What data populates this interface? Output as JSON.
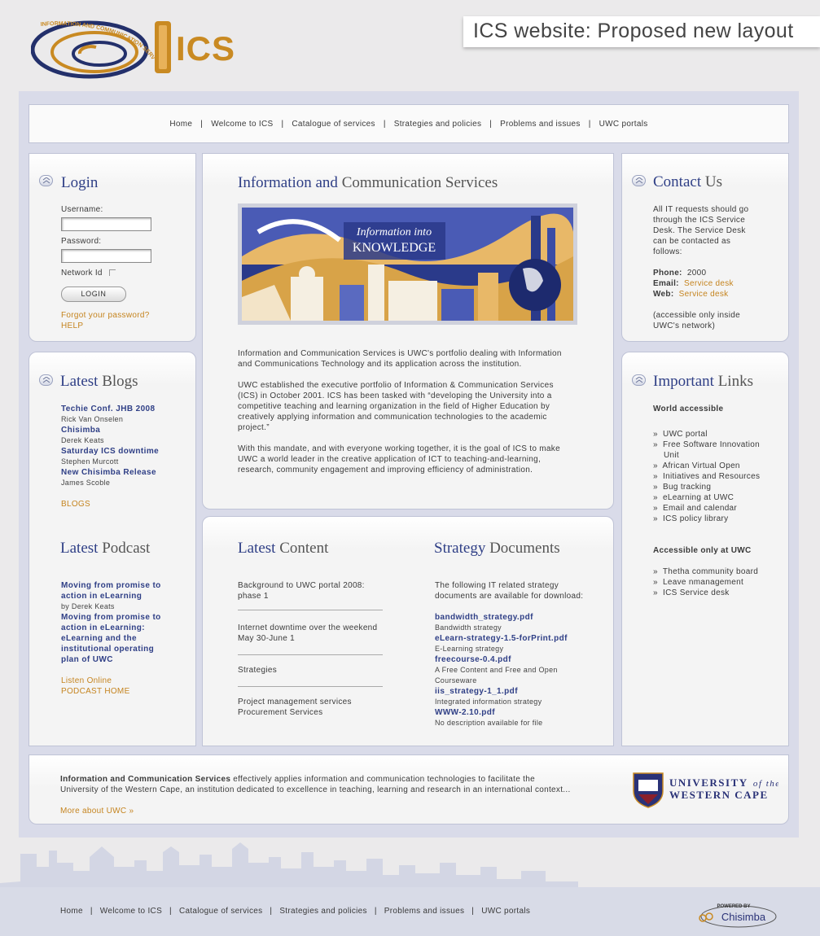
{
  "header": {
    "logo_text": "ICS",
    "logo_ring_text": "INFORMATION AND COMMUNICATION SERVICES",
    "page_title": "ICS website: Proposed new layout"
  },
  "nav": {
    "items": [
      "Home",
      "Welcome to ICS",
      "Catalogue of services",
      "Strategies and policies",
      "Problems and issues",
      "UWC portals"
    ],
    "separator": "|"
  },
  "login": {
    "heading_hl": "Login",
    "username_label": "Username:",
    "password_label": "Password:",
    "network_label": "Network Id",
    "login_button": "LOGIN",
    "forgot": "Forgot your password?",
    "help": "HELP"
  },
  "blogs": {
    "heading_hl": "Latest",
    "heading_rest": " Blogs",
    "items": [
      {
        "title": "Techie Conf. JHB 2008",
        "author": "Rick Van Onselen"
      },
      {
        "title": "Chisimba",
        "author": "Derek Keats"
      },
      {
        "title": "Saturday ICS downtime",
        "author": "Stephen Murcott"
      },
      {
        "title": "New Chisimba Release",
        "author": "James Scoble"
      }
    ],
    "more": "BLOGS"
  },
  "podcast": {
    "heading_hl": "Latest",
    "heading_rest": " Podcast",
    "item1_title_l1": "Moving from promise to",
    "item1_title_l2": "action in eLearning",
    "item1_author": "by Derek Keats",
    "item2_l1": "Moving from promise to",
    "item2_l2": "action in eLearning:",
    "item2_l3": "eLearning and the",
    "item2_l4": "institutional operating",
    "item2_l5": "plan of UWC",
    "listen": "Listen Online",
    "home": "PODCAST HOME"
  },
  "main": {
    "heading_hl": "Information and",
    "heading_rest": " Communication Services",
    "banner_l1": "Information into",
    "banner_l2": "KNOWLEDGE",
    "p1_l1": "Information and Communication Services is UWC's portfolio dealing with Information",
    "p1_l2": "and Communications Technology and its application across the institution.",
    "p2_l1": "UWC established the executive portfolio of Information & Communication Services",
    "p2_l2": "(ICS) in October 2001. ICS has been tasked with “developing the University into a",
    "p2_l3": "competitive teaching and learning organization in the field of Higher Education by",
    "p2_l4": "creatively applying information and communication technologies to the academic",
    "p2_l5": "project.”",
    "p3_l1": "With this mandate, and with everyone working together, it is the goal of ICS to make",
    "p3_l2": "UWC a world leader in the creative application of ICT to teaching-and-learning,",
    "p3_l3": "research, community engagement and improving efficiency of administration."
  },
  "latest_content": {
    "heading_hl": "Latest",
    "heading_rest": " Content",
    "i1_l1": "Background to UWC portal 2008:",
    "i1_l2": "phase 1",
    "i2_l1": "Internet downtime over the weekend",
    "i2_l2": "May 30-June 1",
    "i3": "Strategies",
    "i4_l1": "Project management services",
    "i4_l2": "Procurement Services"
  },
  "strategy": {
    "heading_hl": "Strategy",
    "heading_rest": " Documents",
    "intro_l1": "The following IT related strategy",
    "intro_l2": "documents are available for download:",
    "docs": [
      {
        "file": "bandwidth_strategy.pdf",
        "desc": "Bandwidth strategy"
      },
      {
        "file": "eLearn-strategy-1.5-forPrint.pdf",
        "desc": "E-Learning strategy"
      },
      {
        "file": "freecourse-0.4.pdf",
        "desc": "A Free Content and Free and Open",
        "desc2": "Courseware"
      },
      {
        "file": "iis_strategy-1_1.pdf",
        "desc": "Integrated information strategy"
      },
      {
        "file": "WWW-2.10.pdf",
        "desc": "No description available for file"
      }
    ]
  },
  "contact": {
    "heading_hl": "Contact",
    "heading_rest": " Us",
    "l1": "All IT requests should go",
    "l2": "through the ICS Service",
    "l3": "Desk. The Service Desk",
    "l4": "can be contacted as",
    "l5": "follows:",
    "phone_label": "Phone:",
    "phone": "2000",
    "email_label": "Email:",
    "email": "Service desk",
    "web_label": "Web:",
    "web": "Service desk",
    "note_l1": "(accessible only inside",
    "note_l2": "UWC's network)"
  },
  "links": {
    "heading_hl": "Important",
    "heading_rest": " Links",
    "world_title": "World accessible",
    "bullet": "»",
    "world": [
      "UWC portal",
      "Free Software Innovation",
      "Unit",
      "African Virtual Open",
      "Initiatives and Resources",
      "Bug tracking",
      "eLearning at UWC",
      "Email and calendar",
      "ICS policy library"
    ],
    "uwc_title": "Accessible only at UWC",
    "uwc": [
      "Thetha community board",
      "Leave nmanagement",
      "ICS Service desk"
    ]
  },
  "footer": {
    "bold": "Information and Communication Services",
    "l1_rest": " effectively applies information and communication technologies to facilitate the",
    "l2": "University of the Western Cape, an institution dedicated to excellence in teaching, learning and research in an international context...",
    "more": "More about UWC »",
    "uwc_l1": "UNIVERSITY",
    "uwc_of": "of the",
    "uwc_l2": "WESTERN CAPE",
    "powered_by": "POWERED BY",
    "chisimba": "Chisimba"
  },
  "colors": {
    "accent_blue": "#2f3f86",
    "accent_orange": "#c5841f",
    "background": "#ebeaeb",
    "frame": "#d9dbe9"
  }
}
